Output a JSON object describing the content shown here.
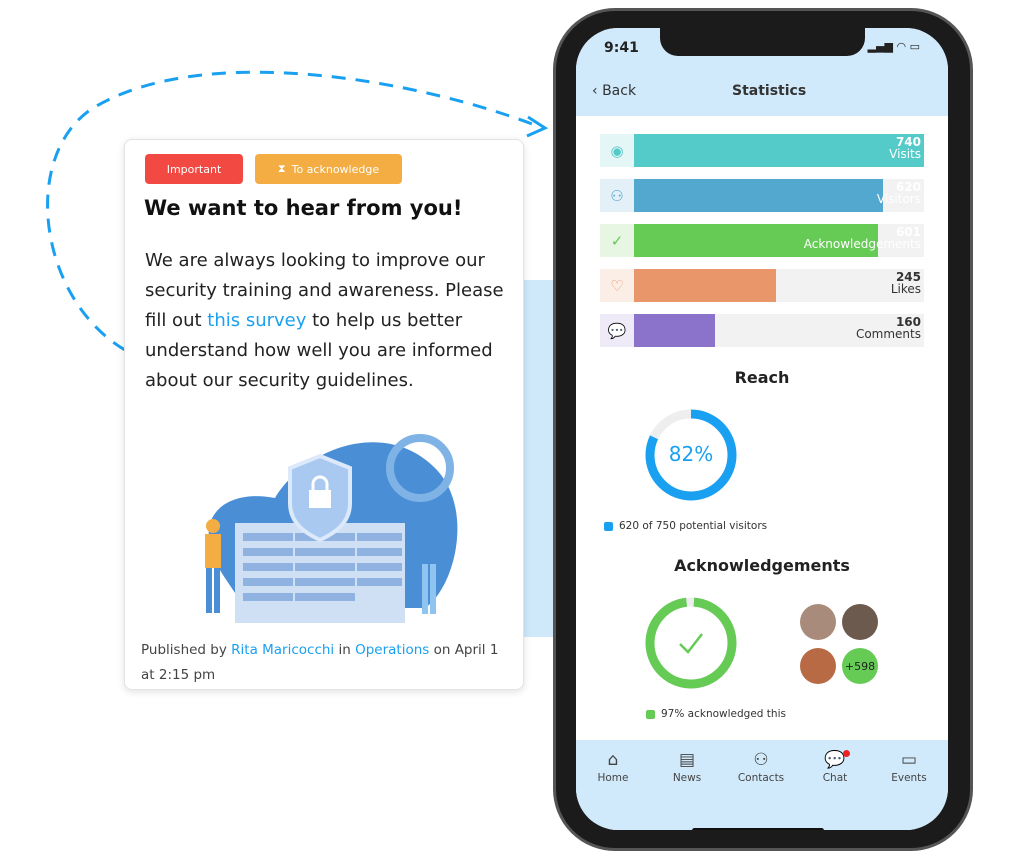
{
  "post": {
    "tags": [
      {
        "label": "Important",
        "color": "#f24a42"
      },
      {
        "label": "To acknowledge",
        "color": "#f3ad42",
        "icon": "hourglass-icon"
      }
    ],
    "title": "We want to hear from you!",
    "body_before": "We are always looking to improve our security training and awareness. Please fill out ",
    "link": "this survey",
    "body_after": " to help us better understand how well you are informed about our security guidelines.",
    "footer": {
      "prefix": "Published by ",
      "author": "Rita Maricocchi",
      "mid": " in ",
      "channel": "Operations",
      "suffix": " on April 1 at 2:15 pm"
    }
  },
  "phone": {
    "time": "9:41",
    "back": "Back",
    "title": "Statistics",
    "stats": [
      {
        "value": "740",
        "label": "Visits",
        "icon": "eye-icon",
        "color": "#54cbc9",
        "bg": "#e4f6f6",
        "fill": 1.0
      },
      {
        "value": "620",
        "label": "Visitors",
        "icon": "users-icon",
        "color": "#53a8cf",
        "bg": "#e3f0f7",
        "fill": 0.86
      },
      {
        "value": "601",
        "label": "Acknowledgements",
        "icon": "check-icon",
        "color": "#65cb55",
        "bg": "#e6f6e3",
        "fill": 0.84
      },
      {
        "value": "245",
        "label": "Likes",
        "icon": "heart-icon",
        "color": "#e9966a",
        "bg": "#fbeee6",
        "fill": 0.49
      },
      {
        "value": "160",
        "label": "Comments",
        "icon": "comments-icon",
        "color": "#8b73cc",
        "bg": "#eeeaf8",
        "fill": 0.28
      }
    ],
    "reach": {
      "title": "Reach",
      "percent": "82%",
      "fraction": 0.82,
      "legend": "620 of 750 potential visitors",
      "color": "#1aa0f0"
    },
    "ack": {
      "title": "Acknowledgements",
      "fraction": 0.97,
      "legend": "97% acknowledged this",
      "more": "+598",
      "color": "#65cb55"
    },
    "nav": [
      {
        "label": "Home",
        "icon": "home-icon"
      },
      {
        "label": "News",
        "icon": "news-icon"
      },
      {
        "label": "Contacts",
        "icon": "contacts-icon"
      },
      {
        "label": "Chat",
        "icon": "chat-icon",
        "badge": true
      },
      {
        "label": "Events",
        "icon": "folder-icon"
      }
    ]
  }
}
